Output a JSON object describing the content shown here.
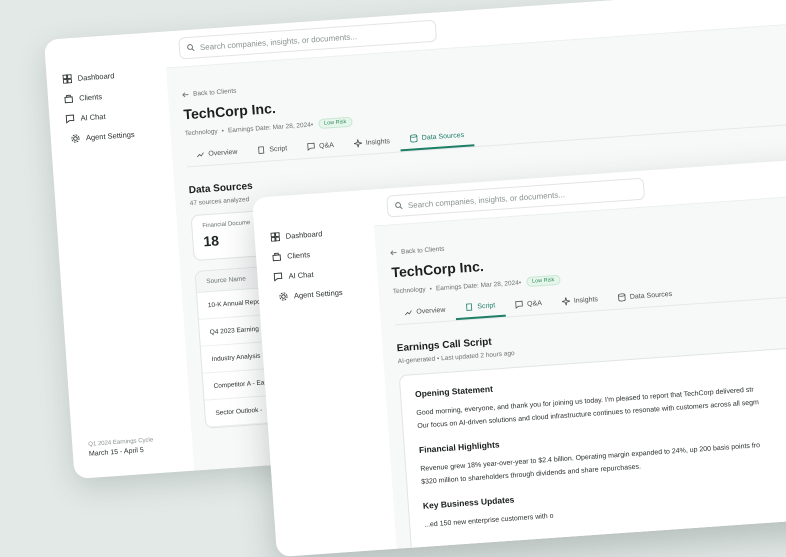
{
  "nav": {
    "items": [
      {
        "label": "Dashboard",
        "icon": "dashboard-icon"
      },
      {
        "label": "Clients",
        "icon": "clients-icon"
      },
      {
        "label": "AI Chat",
        "icon": "chat-icon"
      },
      {
        "label": "Agent Settings",
        "icon": "gear-icon"
      }
    ]
  },
  "cycle": {
    "label": "Q1 2024 Earnings Cycle",
    "dates": "March 15 - April 5"
  },
  "search": {
    "placeholder": "Search companies, insights, or documents..."
  },
  "company": {
    "back": "Back to Clients",
    "name": "TechCorp Inc.",
    "sector": "Technology",
    "earnings_date": "Earnings Date: Mar 28, 2024",
    "risk": "Low Risk"
  },
  "tabs": [
    {
      "label": "Overview",
      "icon": "trend-icon"
    },
    {
      "label": "Script",
      "icon": "document-icon"
    },
    {
      "label": "Q&A",
      "icon": "chat-icon"
    },
    {
      "label": "Insights",
      "icon": "sparkle-icon"
    },
    {
      "label": "Data Sources",
      "icon": "database-icon"
    }
  ],
  "back_window": {
    "active_tab": "Data Sources",
    "section_title": "Data Sources",
    "section_sub": "47 sources analyzed",
    "stat_label": "Financial Docume",
    "stat_value": "18",
    "table_header": "Source Name",
    "rows": [
      "10-K Annual Repo",
      "Q4 2023 Earning",
      "Industry Analysis",
      "Competitor A - Ea",
      "Sector Outlook -"
    ]
  },
  "front_window": {
    "active_tab": "Script",
    "section_title": "Earnings Call Script",
    "section_sub": "AI-generated • Last updated 2 hours ago",
    "blocks": [
      {
        "heading": "Opening Statement",
        "lines": [
          "Good morning, everyone, and thank you for joining us today. I'm pleased to report that TechCorp delivered str",
          "Our focus on AI-driven solutions and cloud infrastructure continues to resonate with customers across all segm"
        ]
      },
      {
        "heading": "Financial Highlights",
        "lines": [
          "Revenue grew 18% year-over-year to $2.4 billion. Operating margin expanded to 24%, up 200 basis points fro",
          "$320 million to shareholders through dividends and share repurchases."
        ]
      },
      {
        "heading": "Key Business Updates",
        "lines": [
          "...ed 150 new enterprise customers with o"
        ]
      }
    ]
  },
  "colors": {
    "accent": "#1e7f66",
    "badge_bg": "#e7f6ec",
    "badge_text": "#2f8b56"
  }
}
